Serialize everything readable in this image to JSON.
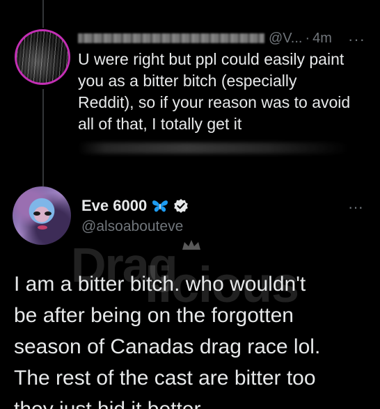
{
  "reply": {
    "handle_suffix": "@V...",
    "separator": "·",
    "time": "4m",
    "more_label": "···",
    "text_lines": [
      "U were right but ppl could easily paint",
      "you as a bitter bitch (especially",
      "Reddit), so if your reason was to avoid",
      "all of that, I totally get it"
    ]
  },
  "main_tweet": {
    "display_name": "Eve 6000",
    "handle": "@alsoabouteve",
    "more_label": "···",
    "text_lines": [
      "I am a bitter bitch. who wouldn't",
      "be after being on the forgotten",
      "season of Canadas drag race lol.",
      "The rest of the cast are bitter too",
      "they just hid it better"
    ]
  },
  "watermark": {
    "part1": "Drag",
    "part2": "licious"
  },
  "colors": {
    "background": "#000000",
    "text": "#e7e9ea",
    "secondary": "#71767b",
    "verified_blue": "#1d9bf0",
    "avatar_ring": "#c42fb5"
  },
  "icons": [
    "butterfly-icon",
    "verified-icon",
    "more-icon",
    "crown-icon"
  ]
}
